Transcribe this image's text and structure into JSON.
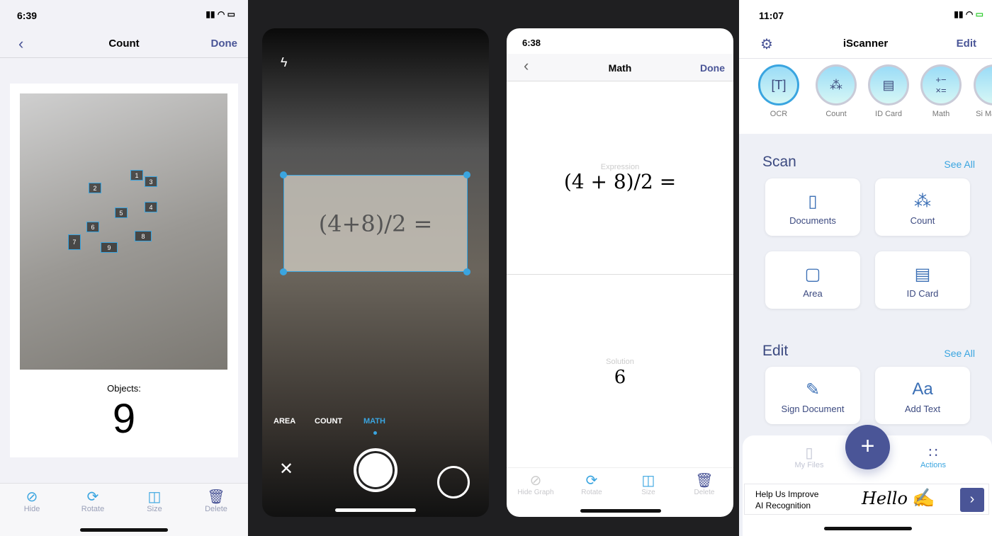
{
  "count_screen": {
    "time": "6:39",
    "title": "Count",
    "done": "Done",
    "objects_label": "Objects:",
    "objects_value": "9",
    "markers": [
      "1",
      "2",
      "3",
      "4",
      "5",
      "6",
      "7",
      "8",
      "9"
    ],
    "toolbar": [
      {
        "label": "Hide",
        "icon": "eye-slash-icon"
      },
      {
        "label": "Rotate",
        "icon": "rotate-icon"
      },
      {
        "label": "Size",
        "icon": "size-icon"
      },
      {
        "label": "Delete",
        "icon": "trash-icon"
      }
    ]
  },
  "camera_screen": {
    "modes": [
      "AREA",
      "COUNT",
      "MATH"
    ],
    "active_mode": "MATH",
    "handwriting": "(4+8)/2 ="
  },
  "math_screen": {
    "time": "6:38",
    "title": "Math",
    "done": "Done",
    "expression_label": "Expression",
    "expression": "(4 + 8)/2 =",
    "solution_label": "Solution",
    "solution": "6",
    "toolbar": [
      {
        "label": "Hide Graph"
      },
      {
        "label": "Rotate"
      },
      {
        "label": "Size"
      },
      {
        "label": "Delete"
      }
    ]
  },
  "home_screen": {
    "time": "11:07",
    "title": "iScanner",
    "edit": "Edit",
    "quick": [
      {
        "label": "OCR"
      },
      {
        "label": "Count"
      },
      {
        "label": "ID Card"
      },
      {
        "label": "Math"
      },
      {
        "label": "Si Mar"
      }
    ],
    "scan_title": "Scan",
    "see_all": "See All",
    "scan_items": [
      "Documents",
      "Count",
      "Area",
      "ID Card"
    ],
    "edit_title": "Edit",
    "edit_items": [
      "Sign Document",
      "Add Text"
    ],
    "tabs": {
      "files": "My Files",
      "actions": "Actions"
    },
    "banner": {
      "text1": "Help Us Improve",
      "text2": "AI Recognition",
      "script": "Hello"
    },
    "accent": "#4a5597",
    "highlight": "#3aa5e0"
  }
}
